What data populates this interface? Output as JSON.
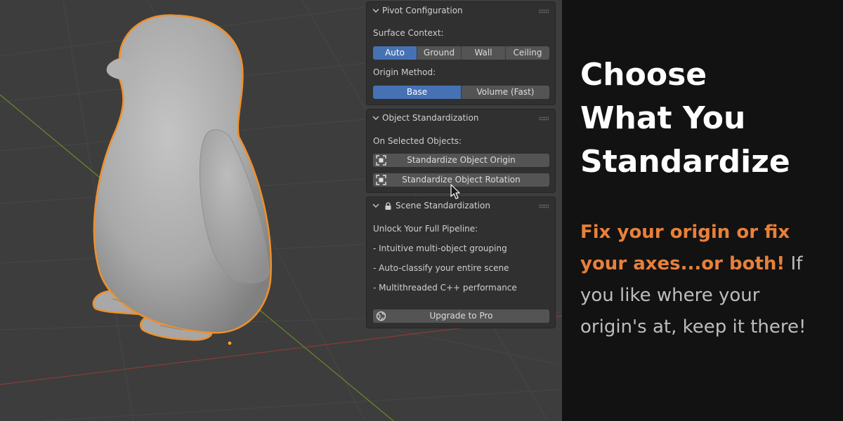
{
  "viewport": {
    "object": "penguin-mesh"
  },
  "pivot_panel": {
    "title": "Pivot Configuration",
    "surface_context_label": "Surface Context:",
    "surface_options": [
      "Auto",
      "Ground",
      "Wall",
      "Ceiling"
    ],
    "surface_selected": "Auto",
    "origin_method_label": "Origin Method:",
    "origin_options": [
      "Base",
      "Volume (Fast)"
    ],
    "origin_selected": "Base"
  },
  "object_panel": {
    "title": "Object Standardization",
    "section_label": "On Selected Objects:",
    "origin_button": "Standardize Object Origin",
    "rotation_button": "Standardize Object Rotation"
  },
  "scene_panel": {
    "title": "Scene Standardization",
    "unlock_label": "Unlock Your Full Pipeline:",
    "features": [
      "- Intuitive multi-object grouping",
      "- Auto-classify your entire scene",
      "- Multithreaded C++ performance"
    ],
    "upgrade_button": "Upgrade to Pro"
  },
  "promo": {
    "headline": [
      "Choose",
      "What You",
      "Standardize"
    ],
    "highlight": "Fix your origin or fix your axes...or both!",
    "body": " If you like where your origin's at, keep it there!",
    "accent_color": "#e8803a"
  },
  "colors": {
    "selection_outline": "#f0902a",
    "active_button": "#4672b4"
  }
}
